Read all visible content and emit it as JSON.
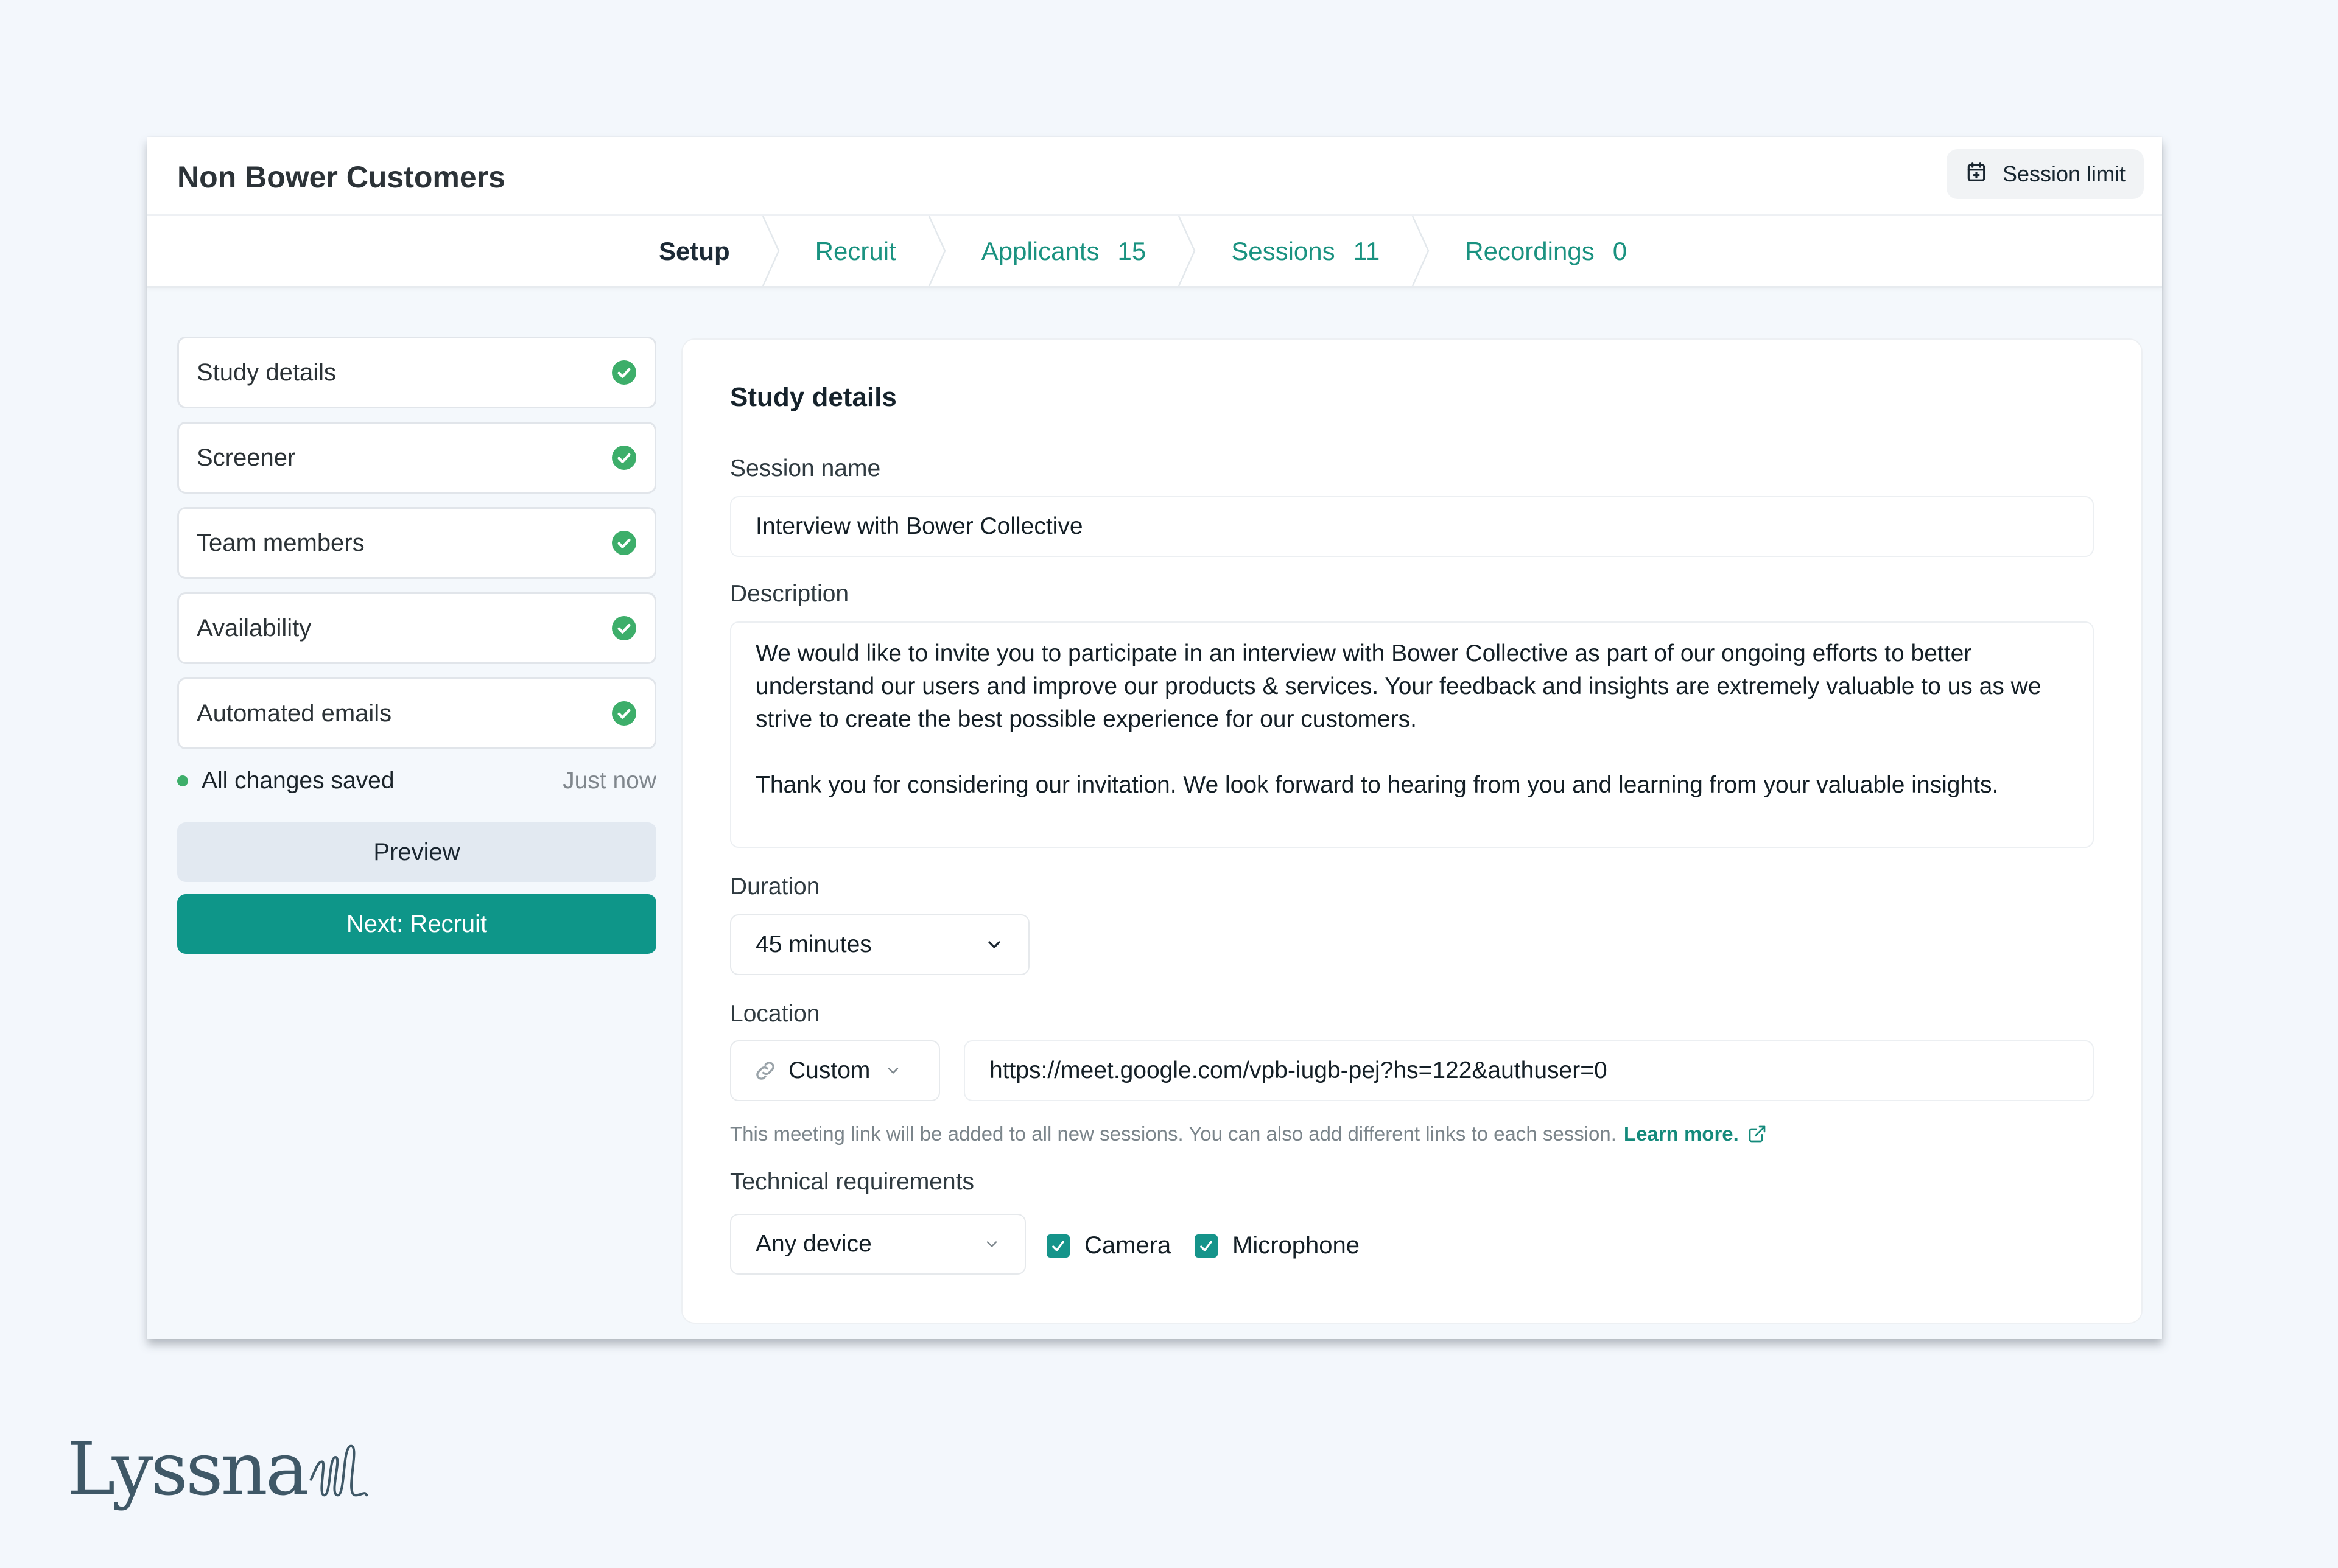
{
  "header": {
    "title": "Non Bower Customers",
    "session_limit_label": "Session limit",
    "session_limit_icon": "calendar-plus-icon"
  },
  "tabs": [
    {
      "label": "Setup",
      "count": null,
      "active": true
    },
    {
      "label": "Recruit",
      "count": null,
      "active": false
    },
    {
      "label": "Applicants",
      "count": "15",
      "active": false
    },
    {
      "label": "Sessions",
      "count": "11",
      "active": false
    },
    {
      "label": "Recordings",
      "count": "0",
      "active": false
    }
  ],
  "sidebar": {
    "steps": [
      {
        "label": "Study details",
        "status": "complete",
        "icon": "check-circle-icon"
      },
      {
        "label": "Screener",
        "status": "complete",
        "icon": "check-circle-icon"
      },
      {
        "label": "Team members",
        "status": "complete",
        "icon": "check-circle-icon"
      },
      {
        "label": "Availability",
        "status": "complete",
        "icon": "check-circle-icon"
      },
      {
        "label": "Automated emails",
        "status": "complete",
        "icon": "check-circle-icon"
      }
    ],
    "save_status": "All changes saved",
    "save_time": "Just now",
    "preview_label": "Preview",
    "next_label": "Next: Recruit"
  },
  "main": {
    "section_title": "Study details",
    "session_name": {
      "label": "Session name",
      "value": "Interview with Bower Collective"
    },
    "description": {
      "label": "Description",
      "paragraphs": [
        "We would like to invite you to participate in an interview with Bower Collective as part of our ongoing efforts to better understand our users and improve our products & services. Your feedback and insights are extremely valuable to us as we strive to create the best possible experience for our customers.",
        "Thank you for considering our invitation. We look forward to hearing from you and learning from your valuable insights."
      ]
    },
    "duration": {
      "label": "Duration",
      "value": "45 minutes"
    },
    "location": {
      "label": "Location",
      "type_value": "Custom",
      "type_icon": "link-icon",
      "url_value": "https://meet.google.com/vpb-iugb-pej?hs=122&authuser=0",
      "helper_text": "This meeting link will be added to all new sessions. You can also add different links to each session.",
      "learn_more_label": "Learn more."
    },
    "technical_requirements": {
      "label": "Technical requirements",
      "device_value": "Any device",
      "camera_label": "Camera",
      "camera_checked": true,
      "microphone_label": "Microphone",
      "microphone_checked": true
    }
  },
  "brand": {
    "logo_text": "Lyssna"
  },
  "colors": {
    "accent": "#0e9689",
    "tab_link": "#1a9280",
    "success": "#3dae6a",
    "page_bg": "#f3f7fc"
  }
}
